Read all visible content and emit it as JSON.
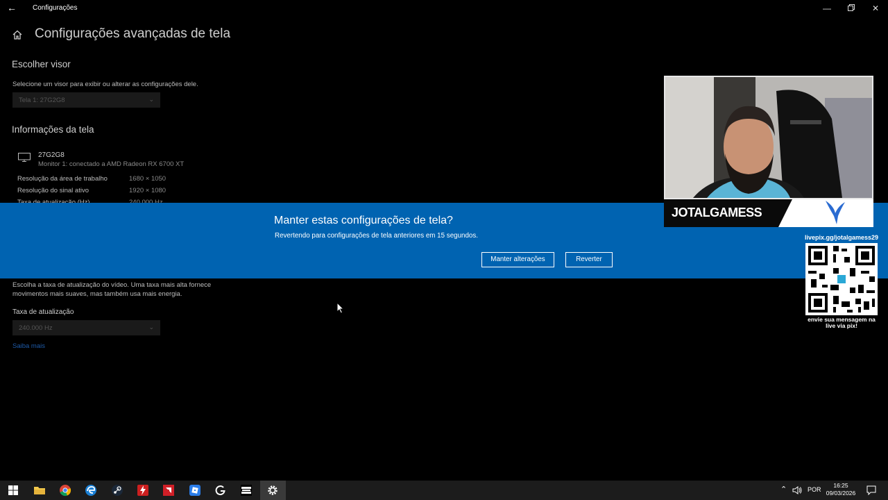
{
  "window": {
    "title": "Configurações",
    "back_icon": "back-arrow-icon",
    "controls": [
      "minimize",
      "restore",
      "close"
    ]
  },
  "page": {
    "title": "Configurações avançadas de tela"
  },
  "choose_display": {
    "heading": "Escolher visor",
    "description": "Selecione um visor para exibir ou alterar as configurações dele.",
    "selected": "Tela 1: 27G2G8"
  },
  "display_info": {
    "heading": "Informações da tela",
    "monitor_name": "27G2G8",
    "monitor_desc": "Monitor 1: conectado a AMD Radeon RX 6700 XT",
    "rows": [
      {
        "label": "Resolução da área de trabalho",
        "value": "1680 × 1050"
      },
      {
        "label": "Resolução do sinal ativo",
        "value": "1920 × 1080"
      },
      {
        "label": "Taxa de atualização (Hz)",
        "value": "240.000 Hz"
      }
    ]
  },
  "refresh": {
    "description_line1": "Escolha a taxa de atualização do vídeo. Uma taxa mais alta fornece",
    "description_line2": "movimentos mais suaves, mas também usa mais energia.",
    "label": "Taxa de atualização",
    "selected": "240.000 Hz",
    "link": "Saiba mais"
  },
  "dialog": {
    "title": "Manter estas configurações de tela?",
    "message": "Revertendo para configurações de tela anteriores em 15 segundos.",
    "keep_label": "Manter alterações",
    "revert_label": "Reverter",
    "bg_color": "#0063b1"
  },
  "overlay": {
    "streamer_name": "JOTALGAMESS",
    "qr_title": "livepix.gg/jotalgamess29",
    "qr_footer_line1": "envie sua mensagem na",
    "qr_footer_line2": "live via pix!"
  },
  "taskbar": {
    "icons": [
      "windows-start-icon",
      "file-explorer-icon",
      "chrome-icon",
      "edge-icon",
      "steam-icon",
      "flash-app-icon",
      "amd-icon",
      "roblox-icon",
      "logitech-g-icon",
      "call-of-duty-icon",
      "settings-icon"
    ],
    "language": "POR",
    "time": "16:25",
    "date": "09/03/2026"
  }
}
